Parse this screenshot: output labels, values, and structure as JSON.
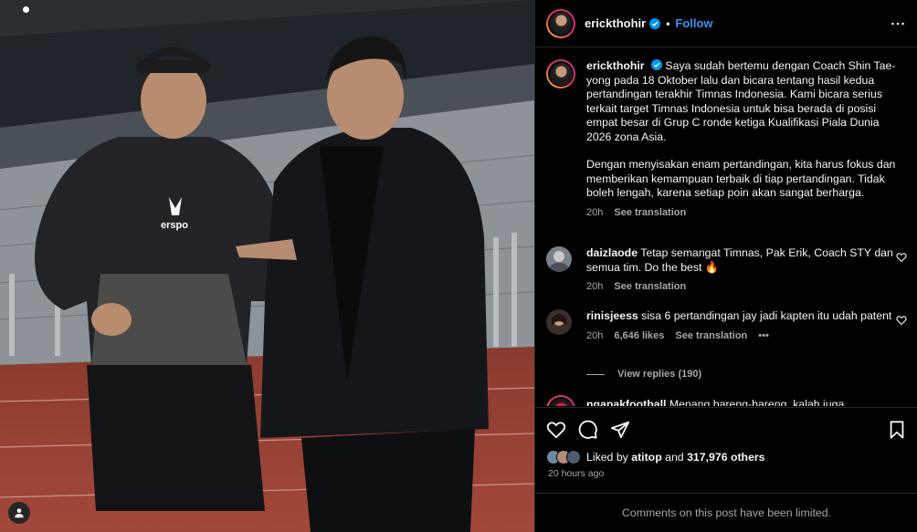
{
  "post": {
    "username": "erickthohir",
    "follow_label": "Follow",
    "separator": "•",
    "caption_p1": "Saya sudah bertemu dengan Coach Shin Tae-yong pada 18 Oktober lalu dan bicara tentang hasil kedua pertandingan terakhir Timnas Indonesia. Kami bicara serius terkait target Timnas Indonesia untuk bisa berada di posisi empat besar di Grup C ronde ketiga Kualifikasi Piala Dunia 2026 zona Asia.",
    "caption_p2": "Dengan menyisakan enam pertandingan, kita harus fokus dan memberikan kemampuan terbaik di tiap pertandingan. Tidak boleh lengah, karena setiap poin akan sangat berharga.",
    "caption_time": "20h",
    "see_translation": "See translation",
    "icons": [
      "verified-badge-icon",
      "more-options-icon",
      "heart-icon",
      "comment-icon",
      "share-icon",
      "bookmark-icon",
      "user-tag-icon"
    ],
    "accent_color": "#0095f6"
  },
  "comments": [
    {
      "username": "daizlaode",
      "text": "Tetap semangat Timnas, Pak Erik, Coach STY dan semua tim. Do the best 🔥",
      "time": "20h",
      "see_translation": "See translation"
    },
    {
      "username": "rinisjeess",
      "text": "sisa 6 pertandingan jay jadi kapten itu udah patent",
      "time": "20h",
      "likes": "6,646 likes",
      "see_translation": "See translation",
      "more": "•••",
      "view_replies": "View replies (190)"
    },
    {
      "username": "ngapakfootball",
      "text": "Menang bareng-bareng, kalah juga"
    }
  ],
  "likes": {
    "prefix": "Liked by",
    "user": "atitop",
    "and": "and",
    "count": "317,976 others"
  },
  "post_time": "20 hours ago",
  "comments_limited": "Comments on this post have been limited."
}
